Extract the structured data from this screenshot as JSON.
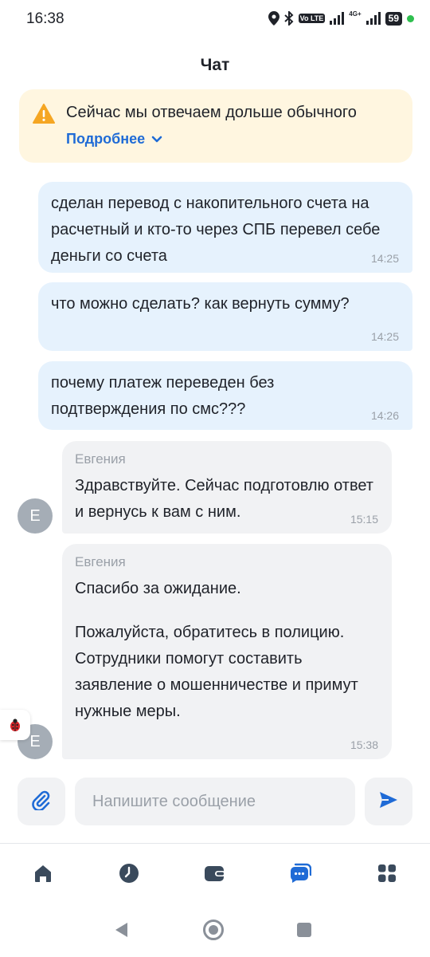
{
  "status_bar": {
    "time": "16:38",
    "volte": "Vo LTE",
    "network": "4G+",
    "battery": "59"
  },
  "header": {
    "title": "Чат"
  },
  "notice": {
    "text": "Сейчас мы отвечаем дольше обычного",
    "more_label": "Подробнее",
    "icon": "warning-icon",
    "accent_color": "#f5a623"
  },
  "messages": [
    {
      "direction": "out",
      "text": "сделан перевод с накопительного счета на расчетный и кто-то через СПБ перевел себе деньги со счета",
      "time": "14:25"
    },
    {
      "direction": "out",
      "text": "что можно сделать? как вернуть сумму?",
      "time": "14:25"
    },
    {
      "direction": "out",
      "text": "почему платеж переведен без подтверждения по смс???",
      "time": "14:26"
    },
    {
      "direction": "in",
      "sender": "Евгения",
      "avatar": "Е",
      "text": "Здравствуйте. Сейчас подготовлю ответ и вернусь к вам с ним.",
      "time": "15:15"
    },
    {
      "direction": "in",
      "sender": "Евгения",
      "avatar": "Е",
      "text": "Спасибо за ожидание.",
      "text2": "Пожалуйста, обратитесь в полицию. Сотрудники помогут составить заявление о мошенничестве и примут нужные меры.",
      "time": "15:38"
    }
  ],
  "composer": {
    "placeholder": "Напишите сообщение",
    "value": "",
    "attach_icon": "paperclip-icon",
    "send_icon": "send-icon"
  },
  "tabbar": {
    "items": [
      "home-icon",
      "history-icon",
      "wallet-icon",
      "chat-icon",
      "services-icon"
    ],
    "active": "chat-icon",
    "active_color": "#1f6bd6",
    "inactive_color": "#3a4a5c"
  },
  "debug_icon": "ladybug-icon"
}
